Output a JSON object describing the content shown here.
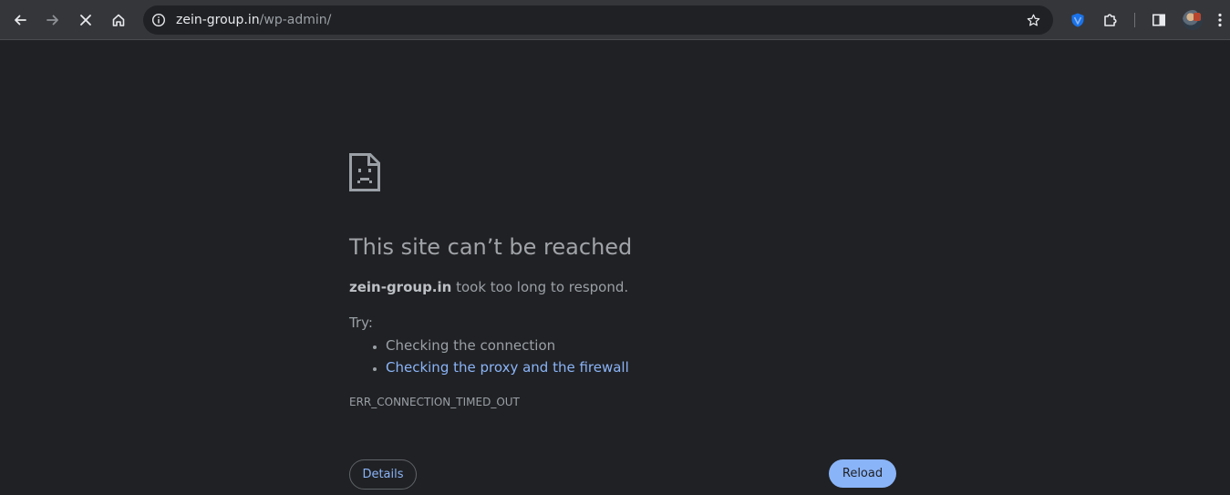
{
  "browser": {
    "url_domain": "zein-group.in",
    "url_path": "/wp-admin/",
    "icons": {
      "back": "back-arrow-icon",
      "forward": "forward-arrow-icon",
      "stop": "close-icon",
      "home": "home-icon",
      "site_info": "info-icon",
      "bookmark": "star-icon",
      "extension": "shield-extension-icon",
      "extensions_menu": "puzzle-icon",
      "side_panel": "side-panel-icon",
      "menu": "kebab-menu-icon"
    }
  },
  "error_page": {
    "icon": "sad-document-icon",
    "title": "This site can’t be reached",
    "host": "zein-group.in",
    "message_suffix": " took too long to respond.",
    "try_label": "Try:",
    "suggestions": [
      "Checking the connection",
      "Checking the proxy and the firewall"
    ],
    "error_code": "ERR_CONNECTION_TIMED_OUT",
    "details_label": "Details",
    "reload_label": "Reload"
  },
  "colors": {
    "page_background": "#202124",
    "toolbar_background": "#35363a",
    "link": "#8ab4f8",
    "reload_button": "#8ab4f8"
  }
}
